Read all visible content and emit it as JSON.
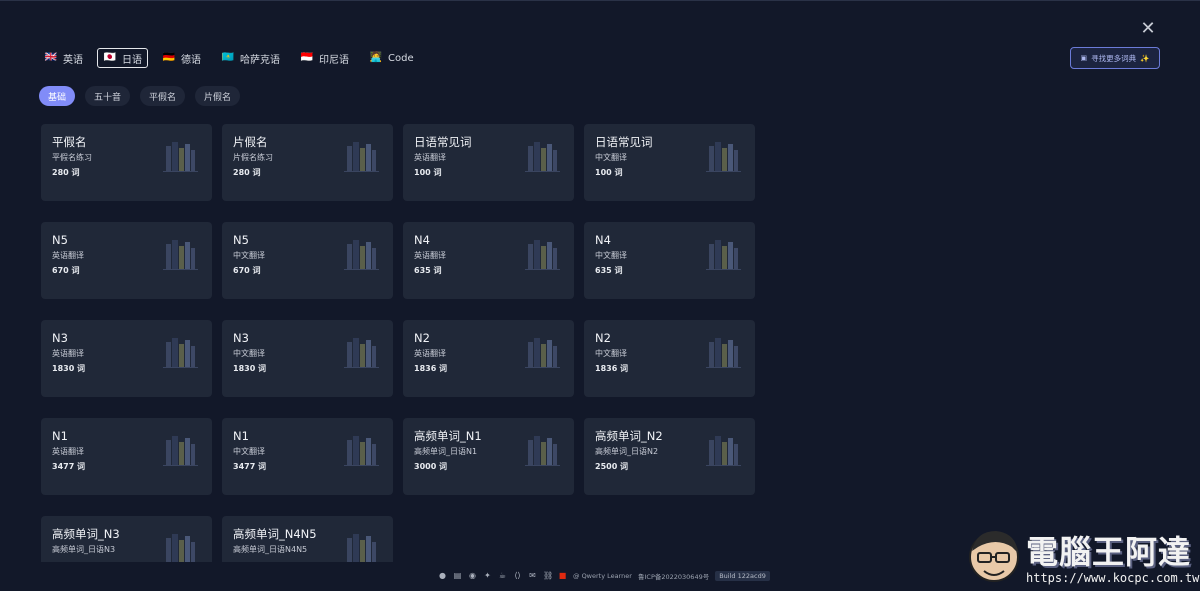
{
  "languages": [
    {
      "flag": "🇬🇧",
      "label": "英语",
      "active": false
    },
    {
      "flag": "🇯🇵",
      "label": "日语",
      "active": true
    },
    {
      "flag": "🇩🇪",
      "label": "德语",
      "active": false
    },
    {
      "flag": "🇰🇿",
      "label": "哈萨克语",
      "active": false
    },
    {
      "flag": "🇮🇩",
      "label": "印尼语",
      "active": false
    },
    {
      "flag": "🧑‍💻",
      "label": "Code",
      "active": false
    }
  ],
  "find_more": {
    "label": "寻找更多词典"
  },
  "tabs": [
    {
      "label": "基础",
      "active": true
    },
    {
      "label": "五十音",
      "active": false
    },
    {
      "label": "平假名",
      "active": false
    },
    {
      "label": "片假名",
      "active": false
    }
  ],
  "cards": [
    {
      "title": "平假名",
      "sub": "平假名练习",
      "count": "280 词"
    },
    {
      "title": "片假名",
      "sub": "片假名练习",
      "count": "280 词"
    },
    {
      "title": "日语常见词",
      "sub": "英语翻译",
      "count": "100 词"
    },
    {
      "title": "日语常见词",
      "sub": "中文翻译",
      "count": "100 词"
    },
    {
      "title": "N5",
      "sub": "英语翻译",
      "count": "670 词"
    },
    {
      "title": "N5",
      "sub": "中文翻译",
      "count": "670 词"
    },
    {
      "title": "N4",
      "sub": "英语翻译",
      "count": "635 词"
    },
    {
      "title": "N4",
      "sub": "中文翻译",
      "count": "635 词"
    },
    {
      "title": "N3",
      "sub": "英语翻译",
      "count": "1830 词"
    },
    {
      "title": "N3",
      "sub": "中文翻译",
      "count": "1830 词"
    },
    {
      "title": "N2",
      "sub": "英语翻译",
      "count": "1836 词"
    },
    {
      "title": "N2",
      "sub": "中文翻译",
      "count": "1836 词"
    },
    {
      "title": "N1",
      "sub": "英语翻译",
      "count": "3477 词"
    },
    {
      "title": "N1",
      "sub": "中文翻译",
      "count": "3477 词"
    },
    {
      "title": "高频单词_N1",
      "sub": "高频单词_日语N1",
      "count": "3000 词"
    },
    {
      "title": "高频单词_N2",
      "sub": "高频单词_日语N2",
      "count": "2500 词"
    },
    {
      "title": "高频单词_N3",
      "sub": "高频单词_日语N3",
      "count": ""
    },
    {
      "title": "高频单词_N4N5",
      "sub": "高频单词_日语N4N5",
      "count": ""
    }
  ],
  "footer": {
    "credit": "@ Qwerty Learner",
    "icp": "鲁ICP备2022030649号",
    "build": "Build 122acd9"
  },
  "watermark": {
    "title": "電腦王阿達",
    "url": "https://www.kocpc.com.tw/"
  },
  "colors": {
    "background": "#121829",
    "card": "#202838",
    "accent": "#818cf8"
  }
}
